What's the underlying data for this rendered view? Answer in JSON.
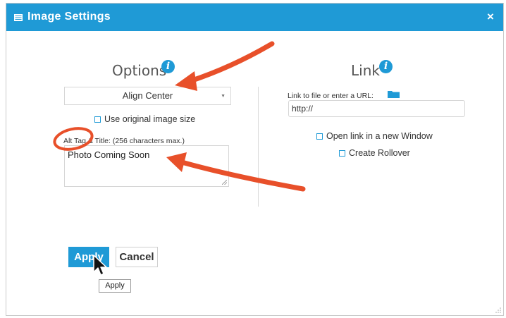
{
  "dialog": {
    "title": "Image Settings",
    "close_label": "×"
  },
  "options": {
    "heading": "Options",
    "info_glyph": "i",
    "align_select": {
      "selected": "Align Center",
      "caret": "▼"
    },
    "use_original_size_label": "Use original image size",
    "alt_label": "Alt Tag & Title: (256 characters max.)",
    "alt_value": "Photo Coming Soon"
  },
  "link": {
    "heading": "Link",
    "info_glyph": "i",
    "url_label": "Link to file or enter a URL:",
    "url_value": "http://",
    "new_window_label": "Open link in a new Window",
    "rollover_label": "Create Rollover"
  },
  "buttons": {
    "apply_label": "Apply",
    "cancel_label": "Cancel",
    "tooltip_text": "Apply"
  },
  "icons": {
    "title_icon": "list-icon",
    "info_icon": "info-icon",
    "folder_icon": "folder-icon",
    "cursor": "mouse-pointer-icon"
  },
  "colors": {
    "accent": "#1f9ad6",
    "annotation": "#e8502a"
  }
}
